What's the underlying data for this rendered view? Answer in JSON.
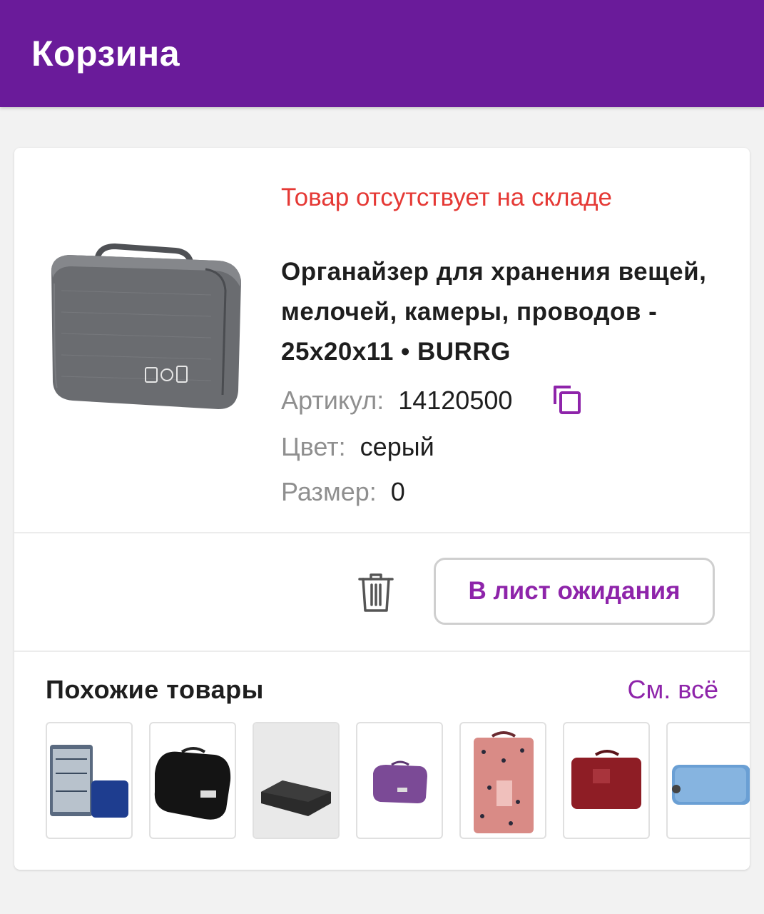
{
  "header": {
    "title": "Корзина"
  },
  "cart_item": {
    "status": "Товар отсутствует на складе",
    "title": "Органайзер для хранения вещей, мелочей, камеры, проводов - 25х20х11 • BURRG",
    "sku_label": "Артикул:",
    "sku_value": "14120500",
    "color_label": "Цвет:",
    "color_value": "серый",
    "size_label": "Размер:",
    "size_value": "0",
    "waitlist_button": "В лист ожидания"
  },
  "similar": {
    "title": "Похожие товары",
    "see_all": "См. всё",
    "items": [
      {
        "name": "similar-item-1",
        "color": "#1e3d8f"
      },
      {
        "name": "similar-item-2",
        "color": "#141414"
      },
      {
        "name": "similar-item-3",
        "color": "#2b2b2b"
      },
      {
        "name": "similar-item-4",
        "color": "#7b4a96"
      },
      {
        "name": "similar-item-5",
        "color": "#d98b86"
      },
      {
        "name": "similar-item-6",
        "color": "#8e1d25"
      },
      {
        "name": "similar-item-7",
        "color": "#6a9fd4"
      }
    ]
  },
  "colors": {
    "brand": "#6a1b9a",
    "accent": "#8e24aa",
    "error": "#e53935"
  }
}
